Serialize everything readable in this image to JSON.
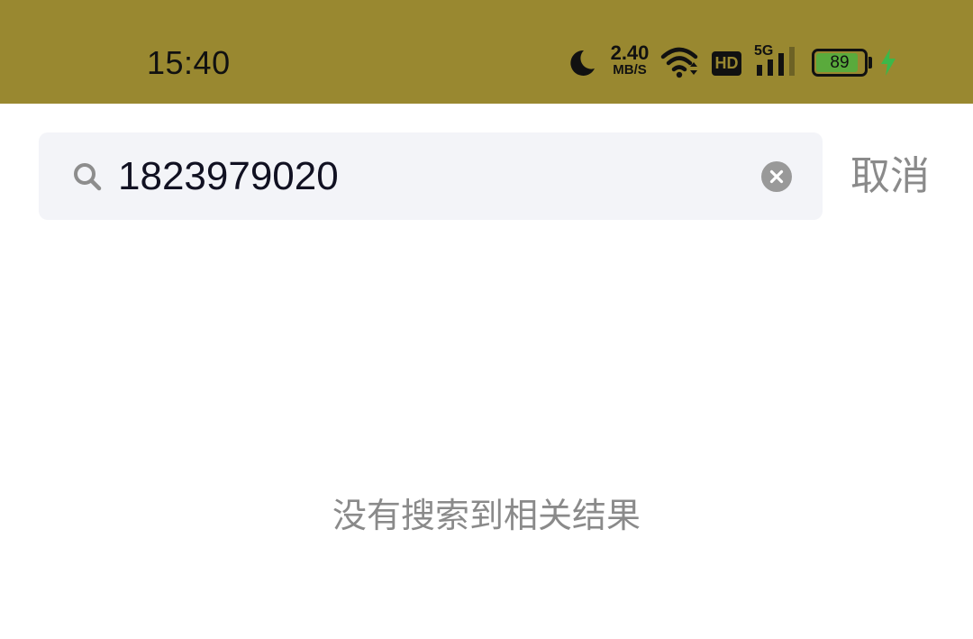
{
  "status_bar": {
    "time": "15:40",
    "net_speed_value": "2.40",
    "net_speed_unit": "MB/S",
    "hd_label": "HD",
    "network_type": "5G",
    "battery_level": "89",
    "battery_fraction": 0.89,
    "icons": [
      "moon-icon",
      "wifi-icon",
      "hd-icon",
      "signal-icon",
      "battery-icon",
      "charging-icon"
    ],
    "background_color": "#998830",
    "battery_color": "#5aaa3c",
    "charging_color": "#3cb84a"
  },
  "search": {
    "value": "1823979020",
    "cancel_label": "取消",
    "icons": [
      "search-icon",
      "clear-icon"
    ]
  },
  "results": {
    "empty_message": "没有搜索到相关结果"
  }
}
